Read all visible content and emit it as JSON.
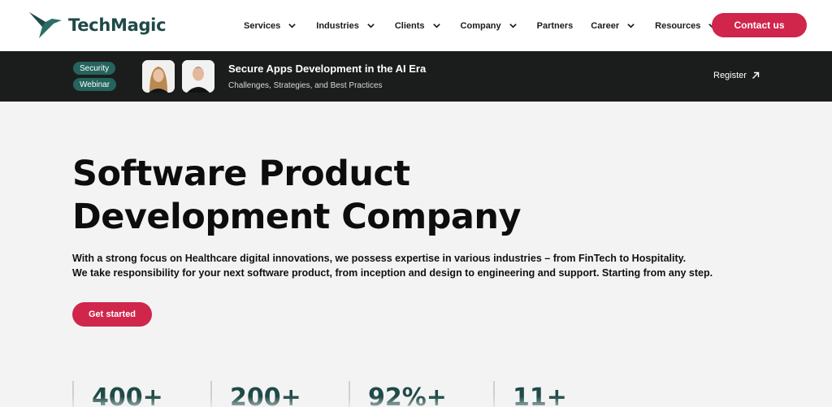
{
  "header": {
    "logo_text": "TechMagic",
    "logo_icon": "hummingbird-logo-icon",
    "nav": [
      {
        "label": "Services",
        "dropdown": true
      },
      {
        "label": "Industries",
        "dropdown": true
      },
      {
        "label": "Clients",
        "dropdown": true
      },
      {
        "label": "Company",
        "dropdown": true
      },
      {
        "label": "Partners",
        "dropdown": false
      },
      {
        "label": "Career",
        "dropdown": true
      },
      {
        "label": "Resources",
        "dropdown": true
      }
    ],
    "contact_label": "Contact us"
  },
  "banner": {
    "tags": [
      "Security",
      "Webinar"
    ],
    "title": "Secure Apps Development in the AI Era",
    "subtitle": "Challenges, Strategies, and Best Practices",
    "register_label": "Register",
    "register_icon": "arrow-up-right-icon"
  },
  "hero": {
    "title_line1": "Software Product",
    "title_line2": "Development Company",
    "desc_line1": "With a strong focus on Healthcare digital innovations, we possess expertise in various industries – from FinTech to Hospitality.",
    "desc_line2": "We take responsibility for your next software product, from inception and design to engineering and support. Starting from any step.",
    "cta_label": "Get started"
  },
  "stats": [
    "400+",
    "200+",
    "92%+",
    "11+"
  ],
  "colors": {
    "accent": "#d0264c",
    "brand_green": "#1e4a47",
    "tag_green": "#24645d",
    "banner_bg": "#1b1d1d",
    "page_bg": "#f3f3f3"
  }
}
